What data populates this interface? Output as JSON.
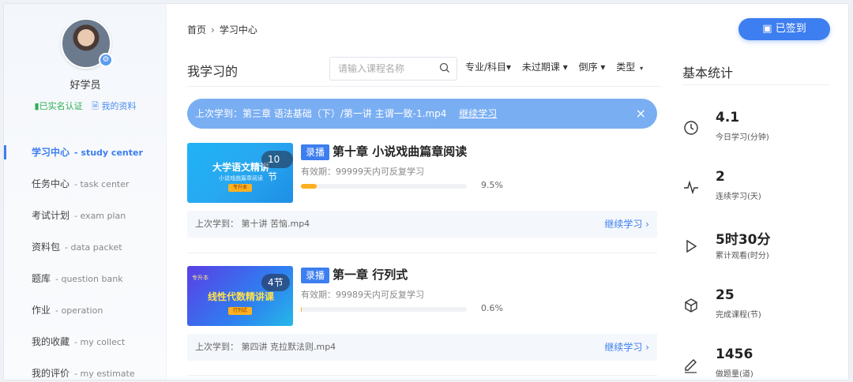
{
  "user": {
    "name": "好学员",
    "verified": "已实名认证",
    "profile_link": "我的资料"
  },
  "nav": [
    {
      "label": "学习中心",
      "en": "- study center",
      "active": true
    },
    {
      "label": "任务中心",
      "en": "- task center"
    },
    {
      "label": "考试计划",
      "en": "- exam plan"
    },
    {
      "label": "资料包",
      "en": "- data packet"
    },
    {
      "label": "题库",
      "en": "- question bank"
    },
    {
      "label": "作业",
      "en": "- operation"
    },
    {
      "label": "我的收藏",
      "en": "- my collect"
    },
    {
      "label": "我的评价",
      "en": "- my estimate"
    }
  ],
  "breadcrumb": {
    "home": "首页",
    "separator": "›",
    "current": "学习中心"
  },
  "main": {
    "title": "我学习的",
    "search_placeholder": "请输入课程名称",
    "filters": [
      "专业/科目▾",
      "未过期课 ▾",
      "倒序 ▾",
      "类型"
    ],
    "filter_caret": "▾",
    "last_bar": {
      "text": "上次学到：第三章 语法基础（下）/第一讲 主谓一致-1.mp4",
      "continue": "继续学习",
      "close": "×"
    },
    "courses": [
      {
        "thumb_title": "大学语文精讲",
        "thumb_subtitle": "小说戏曲篇章阅读",
        "thumb_chip": "专升本",
        "lessons": "10节",
        "badge": "录播",
        "title": "第十章 小说戏曲篇章阅读",
        "validity": "有效期：99999天内可反复学习",
        "progress": 0.095,
        "progress_text": "9.5%",
        "last_learn": "上次学到：  第十讲 苦恼.mp4",
        "continue": "继续学习 ›"
      },
      {
        "thumb_tag": "专升本",
        "thumb_title": "线性代数精讲课",
        "thumb_chip": "行列式",
        "lessons": "4节",
        "badge": "录播",
        "title": "第一章 行列式",
        "validity": "有效期：99989天内可反复学习",
        "progress": 0.006,
        "progress_text": "0.6%",
        "last_learn": "上次学到：  第四讲 克拉默法则.mp4",
        "continue": "继续学习 ›"
      }
    ]
  },
  "stats": {
    "checkin": "已签到",
    "title": "基本统计",
    "items": [
      {
        "icon": "clock-icon",
        "value": "4.1",
        "label": "今日学习(分钟)"
      },
      {
        "icon": "pulse-icon",
        "value": "2",
        "label": "连续学习(天)"
      },
      {
        "icon": "play-icon",
        "value": "5时30分",
        "label": "累计观看(时分)"
      },
      {
        "icon": "box-icon",
        "value": "25",
        "label": "完成课程(节)"
      },
      {
        "icon": "pen-icon",
        "value": "1456",
        "label": "做题量(道)"
      }
    ]
  },
  "colors": {
    "accent": "#3d7ef0",
    "banner": "#7aaef3",
    "progress": "#ffb020",
    "verified": "#2ab055"
  }
}
